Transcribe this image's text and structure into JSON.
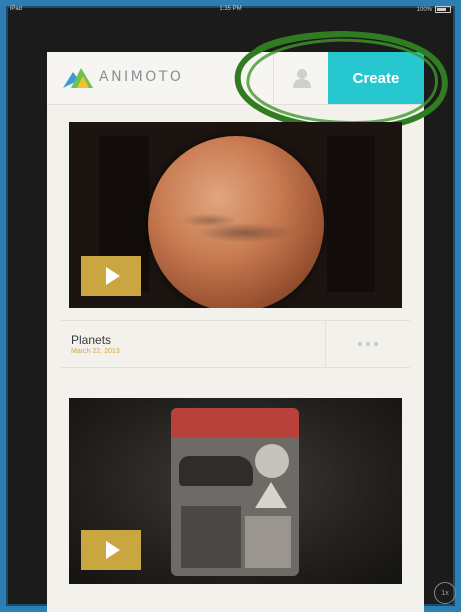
{
  "status_bar": {
    "carrier": "iPad",
    "time": "1:35 PM",
    "battery": "100%"
  },
  "header": {
    "logo_text": "ANIMOTO",
    "user_icon": "user-icon",
    "create_label": "Create"
  },
  "videos": [
    {
      "title": "Planets",
      "date": "March 22, 2013",
      "play_icon": "play-icon",
      "more_icon": "more-dots-icon"
    },
    {
      "play_icon": "play-icon"
    }
  ],
  "overlay": {
    "badge_text": "1x"
  },
  "colors": {
    "accent_create": "#27c7cf",
    "play_button": "#c9a640",
    "date_text": "#d9a441",
    "annotation_circle": "#2f7d20",
    "border": "#2d7fb3"
  }
}
